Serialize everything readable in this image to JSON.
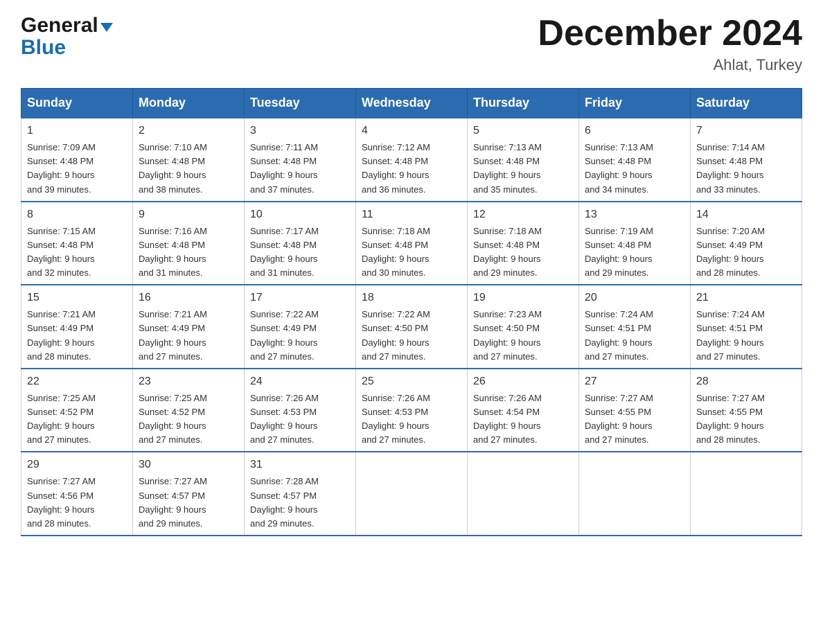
{
  "logo": {
    "general": "General",
    "blue": "Blue",
    "triangle": "▶"
  },
  "title": {
    "month_year": "December 2024",
    "location": "Ahlat, Turkey"
  },
  "weekdays": [
    "Sunday",
    "Monday",
    "Tuesday",
    "Wednesday",
    "Thursday",
    "Friday",
    "Saturday"
  ],
  "weeks": [
    [
      {
        "day": "1",
        "sunrise": "7:09 AM",
        "sunset": "4:48 PM",
        "daylight": "9 hours and 39 minutes."
      },
      {
        "day": "2",
        "sunrise": "7:10 AM",
        "sunset": "4:48 PM",
        "daylight": "9 hours and 38 minutes."
      },
      {
        "day": "3",
        "sunrise": "7:11 AM",
        "sunset": "4:48 PM",
        "daylight": "9 hours and 37 minutes."
      },
      {
        "day": "4",
        "sunrise": "7:12 AM",
        "sunset": "4:48 PM",
        "daylight": "9 hours and 36 minutes."
      },
      {
        "day": "5",
        "sunrise": "7:13 AM",
        "sunset": "4:48 PM",
        "daylight": "9 hours and 35 minutes."
      },
      {
        "day": "6",
        "sunrise": "7:13 AM",
        "sunset": "4:48 PM",
        "daylight": "9 hours and 34 minutes."
      },
      {
        "day": "7",
        "sunrise": "7:14 AM",
        "sunset": "4:48 PM",
        "daylight": "9 hours and 33 minutes."
      }
    ],
    [
      {
        "day": "8",
        "sunrise": "7:15 AM",
        "sunset": "4:48 PM",
        "daylight": "9 hours and 32 minutes."
      },
      {
        "day": "9",
        "sunrise": "7:16 AM",
        "sunset": "4:48 PM",
        "daylight": "9 hours and 31 minutes."
      },
      {
        "day": "10",
        "sunrise": "7:17 AM",
        "sunset": "4:48 PM",
        "daylight": "9 hours and 31 minutes."
      },
      {
        "day": "11",
        "sunrise": "7:18 AM",
        "sunset": "4:48 PM",
        "daylight": "9 hours and 30 minutes."
      },
      {
        "day": "12",
        "sunrise": "7:18 AM",
        "sunset": "4:48 PM",
        "daylight": "9 hours and 29 minutes."
      },
      {
        "day": "13",
        "sunrise": "7:19 AM",
        "sunset": "4:48 PM",
        "daylight": "9 hours and 29 minutes."
      },
      {
        "day": "14",
        "sunrise": "7:20 AM",
        "sunset": "4:49 PM",
        "daylight": "9 hours and 28 minutes."
      }
    ],
    [
      {
        "day": "15",
        "sunrise": "7:21 AM",
        "sunset": "4:49 PM",
        "daylight": "9 hours and 28 minutes."
      },
      {
        "day": "16",
        "sunrise": "7:21 AM",
        "sunset": "4:49 PM",
        "daylight": "9 hours and 27 minutes."
      },
      {
        "day": "17",
        "sunrise": "7:22 AM",
        "sunset": "4:49 PM",
        "daylight": "9 hours and 27 minutes."
      },
      {
        "day": "18",
        "sunrise": "7:22 AM",
        "sunset": "4:50 PM",
        "daylight": "9 hours and 27 minutes."
      },
      {
        "day": "19",
        "sunrise": "7:23 AM",
        "sunset": "4:50 PM",
        "daylight": "9 hours and 27 minutes."
      },
      {
        "day": "20",
        "sunrise": "7:24 AM",
        "sunset": "4:51 PM",
        "daylight": "9 hours and 27 minutes."
      },
      {
        "day": "21",
        "sunrise": "7:24 AM",
        "sunset": "4:51 PM",
        "daylight": "9 hours and 27 minutes."
      }
    ],
    [
      {
        "day": "22",
        "sunrise": "7:25 AM",
        "sunset": "4:52 PM",
        "daylight": "9 hours and 27 minutes."
      },
      {
        "day": "23",
        "sunrise": "7:25 AM",
        "sunset": "4:52 PM",
        "daylight": "9 hours and 27 minutes."
      },
      {
        "day": "24",
        "sunrise": "7:26 AM",
        "sunset": "4:53 PM",
        "daylight": "9 hours and 27 minutes."
      },
      {
        "day": "25",
        "sunrise": "7:26 AM",
        "sunset": "4:53 PM",
        "daylight": "9 hours and 27 minutes."
      },
      {
        "day": "26",
        "sunrise": "7:26 AM",
        "sunset": "4:54 PM",
        "daylight": "9 hours and 27 minutes."
      },
      {
        "day": "27",
        "sunrise": "7:27 AM",
        "sunset": "4:55 PM",
        "daylight": "9 hours and 27 minutes."
      },
      {
        "day": "28",
        "sunrise": "7:27 AM",
        "sunset": "4:55 PM",
        "daylight": "9 hours and 28 minutes."
      }
    ],
    [
      {
        "day": "29",
        "sunrise": "7:27 AM",
        "sunset": "4:56 PM",
        "daylight": "9 hours and 28 minutes."
      },
      {
        "day": "30",
        "sunrise": "7:27 AM",
        "sunset": "4:57 PM",
        "daylight": "9 hours and 29 minutes."
      },
      {
        "day": "31",
        "sunrise": "7:28 AM",
        "sunset": "4:57 PM",
        "daylight": "9 hours and 29 minutes."
      },
      null,
      null,
      null,
      null
    ]
  ],
  "labels": {
    "sunrise": "Sunrise:",
    "sunset": "Sunset:",
    "daylight": "Daylight:"
  }
}
